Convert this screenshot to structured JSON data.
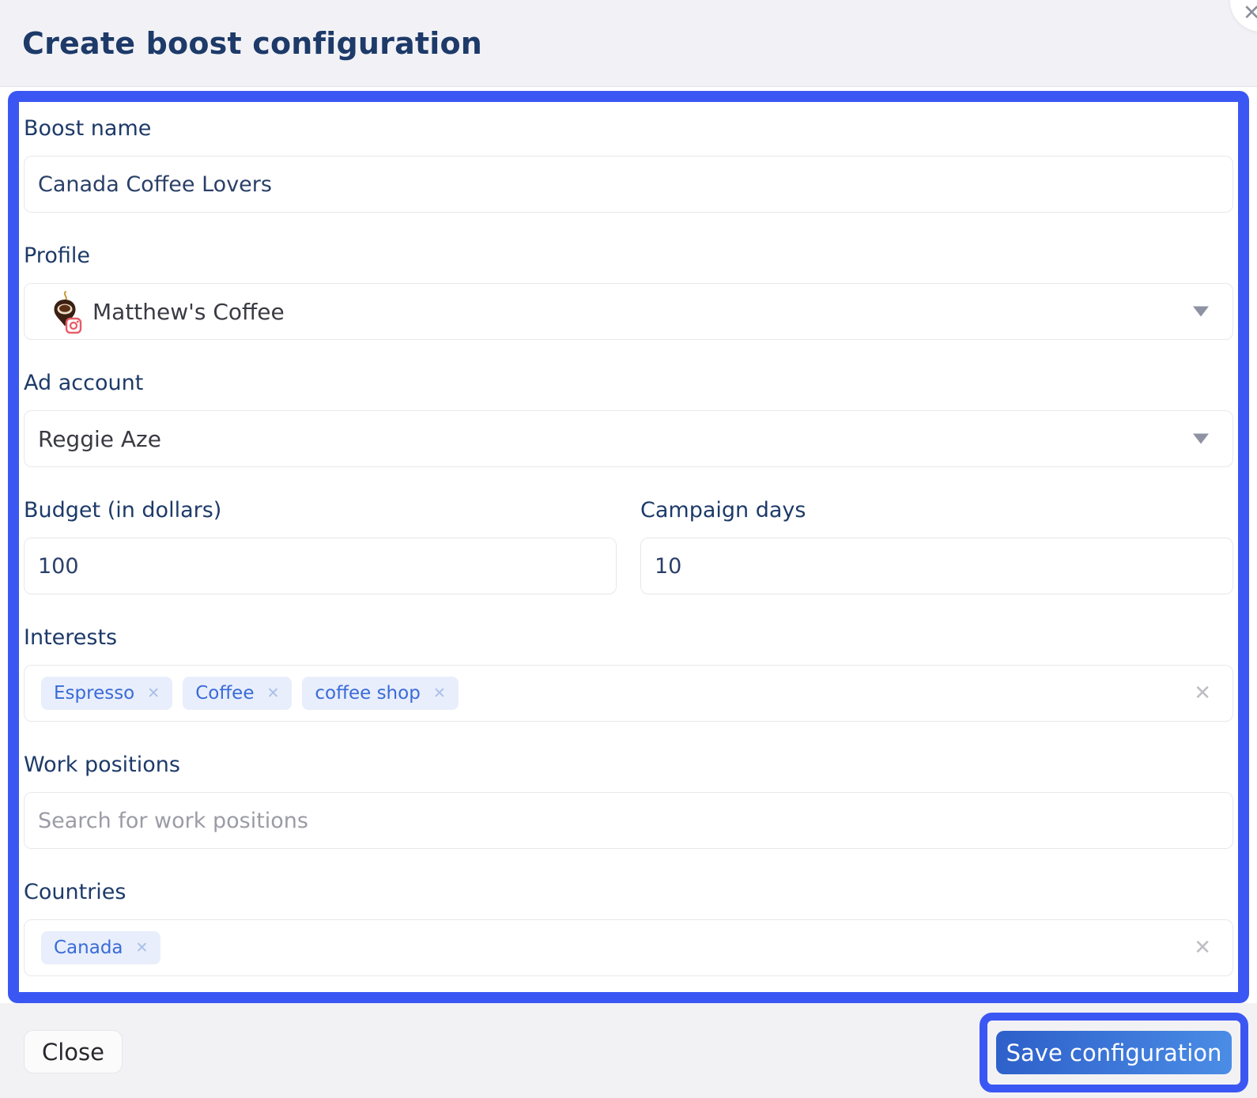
{
  "header": {
    "title": "Create boost configuration"
  },
  "form": {
    "boost_name": {
      "label": "Boost name",
      "value": "Canada Coffee Lovers"
    },
    "profile": {
      "label": "Profile",
      "selected": "Matthew's Coffee",
      "avatar_icon": "coffee-location-pin-with-instagram-badge"
    },
    "ad_account": {
      "label": "Ad account",
      "selected": "Reggie Aze"
    },
    "budget": {
      "label": "Budget (in dollars)",
      "value": "100"
    },
    "campaign_days": {
      "label": "Campaign days",
      "value": "10"
    },
    "interests": {
      "label": "Interests",
      "tags": [
        "Espresso",
        "Coffee",
        "coffee shop"
      ]
    },
    "work_positions": {
      "label": "Work positions",
      "placeholder": "Search for work positions"
    },
    "countries": {
      "label": "Countries",
      "tags": [
        "Canada"
      ]
    }
  },
  "icons": {
    "tag_remove": "✕",
    "field_clear": "✕",
    "corner_close": "✕",
    "dropdown": "▾"
  },
  "footer": {
    "close_label": "Close",
    "save_label": "Save configuration"
  },
  "colors": {
    "annotation_highlight": "#3b57f3",
    "title_navy": "#1d3a69",
    "value_navy": "#2a4068",
    "tag_bg": "#e8eefb",
    "tag_text": "#3a6bd8",
    "tag_remove": "#a9bfe9",
    "save_gradient_start": "#2d5fc9",
    "save_gradient_end": "#4b8de6",
    "header_footer_bg": "#f2f2f5"
  }
}
